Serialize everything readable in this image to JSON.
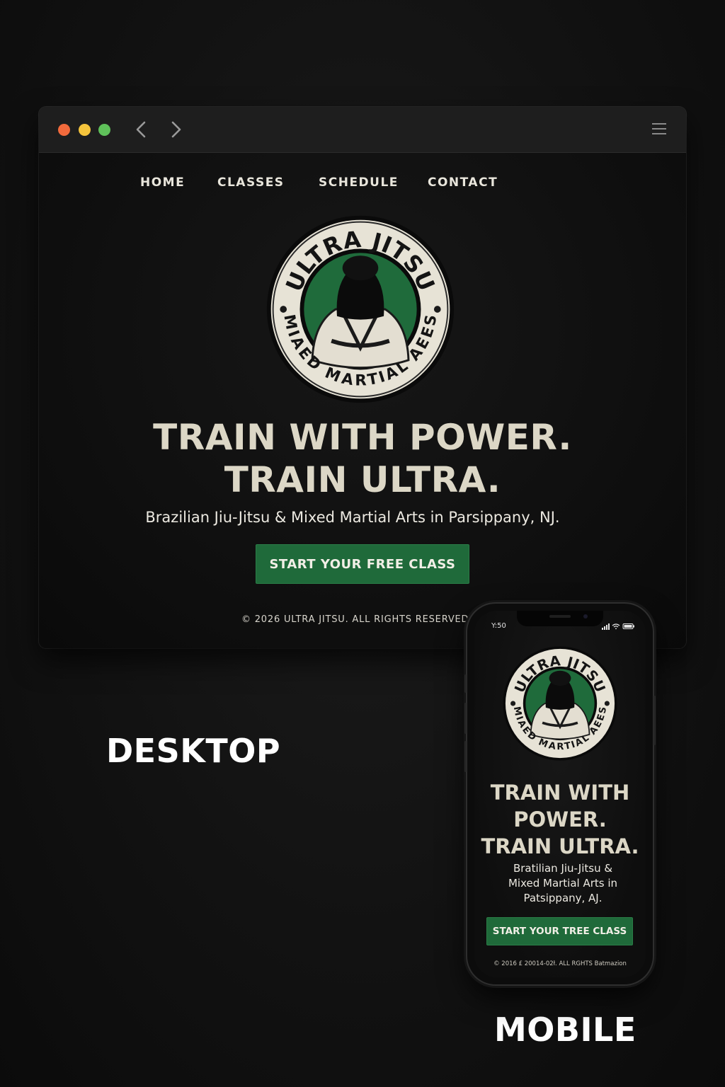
{
  "brand": {
    "name": "ULTRA JITSU",
    "badge_bottom_text": "MIAED MARTIAL AEES",
    "colors": {
      "accent_green": "#1f6a3a",
      "badge_cream": "#e7e3d6",
      "text_cream": "#dcd7c6"
    }
  },
  "desktop": {
    "window_controls": [
      "close",
      "minimize",
      "maximize"
    ],
    "toolbar_icons": [
      "back-arrow-icon",
      "forward-arrow-icon",
      "hamburger-menu-icon"
    ],
    "nav": [
      "HOME",
      "CLASSES",
      "SCHEDULE",
      "CONTACT"
    ],
    "hero": {
      "title_line1": "TRAIN WITH POWER.",
      "title_line2": "TRAIN ULTRA.",
      "subtitle": "Brazilian Jiu-Jitsu & Mixed Martial Arts in Parsippany, NJ.",
      "cta": "START YOUR FREE CLASS"
    },
    "footer": "© 2026 ULTRA JITSU. ALL RIGHTS RESERVED."
  },
  "labels": {
    "desktop": "DESKTOP",
    "mobile": "MOBILE"
  },
  "mobile": {
    "status_time": "Y:50",
    "status_icons": [
      "signal-icon",
      "wifi-icon",
      "battery-icon"
    ],
    "hero": {
      "title_line1": "TRAIN WITH",
      "title_line2": "POWER.",
      "title_line3": "TRAIN ULTRA.",
      "subtitle_line1": "Bratilian Jiu-Jitsu &",
      "subtitle_line2": "Mixed Martial Arts in",
      "subtitle_line3": "Patsippany, AJ.",
      "cta": "START YOUR TREE CLASS"
    },
    "footer": "© 2016 £ 20014-02ł. ALL RGHTS Batmazion"
  }
}
